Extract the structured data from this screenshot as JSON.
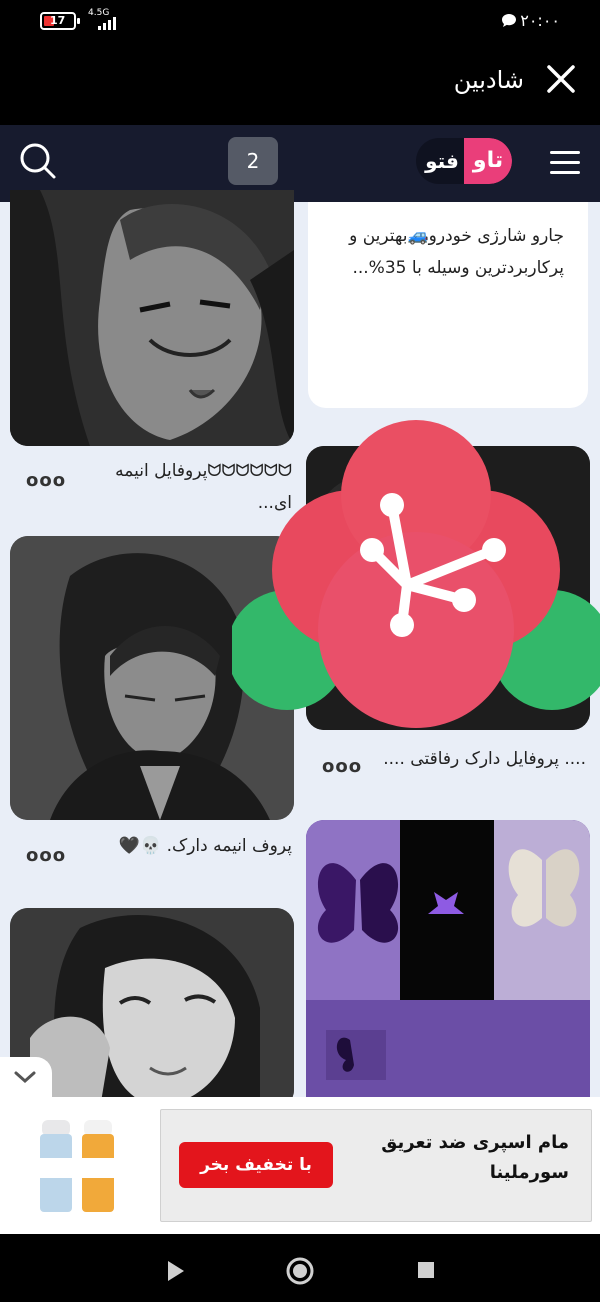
{
  "status_bar": {
    "battery": "17",
    "network": "4.5G",
    "time": "۲۰:۰۰"
  },
  "title_bar": {
    "title": "شادبین",
    "close_icon": "close-icon"
  },
  "app_header": {
    "logo_pink": "تاو",
    "logo_dark": "فتو",
    "tab_count": "2",
    "search_icon": "search-icon",
    "menu_icon": "hamburger-icon"
  },
  "feed": {
    "ad_card_text": "جارو شارژی خودرو🚙بهترین و پرکاربردترین وسیله با 35%...",
    "left": [
      {
        "caption": "ᗢᗢᗢᗢᗢᗢپروفایل انیمه ای...",
        "more": "ooo"
      },
      {
        "caption": "پروف انیمه دارک. 💀🖤",
        "more": "ooo"
      },
      {
        "caption": "",
        "more": ""
      }
    ],
    "right": [
      {
        "caption": ".... پروفایل دارک رفاقتی ....",
        "more": "ooo"
      },
      {
        "caption": "",
        "more": ""
      }
    ]
  },
  "bottom_ad": {
    "title": "مام اسپری ضد تعریق سورملینا",
    "cta": "با تخفیف بخر",
    "collapse_icon": "chevron-down-icon"
  },
  "nav_bar": {
    "back_icon": "play-icon",
    "home_icon": "circle-home-icon",
    "recents_icon": "square-icon"
  },
  "colors": {
    "accent_pink": "#ea3e7a",
    "header_bg": "#171b2e",
    "cta_red": "#e3151c",
    "flower_red": "#e8495e",
    "leaf_green": "#33b86a"
  }
}
